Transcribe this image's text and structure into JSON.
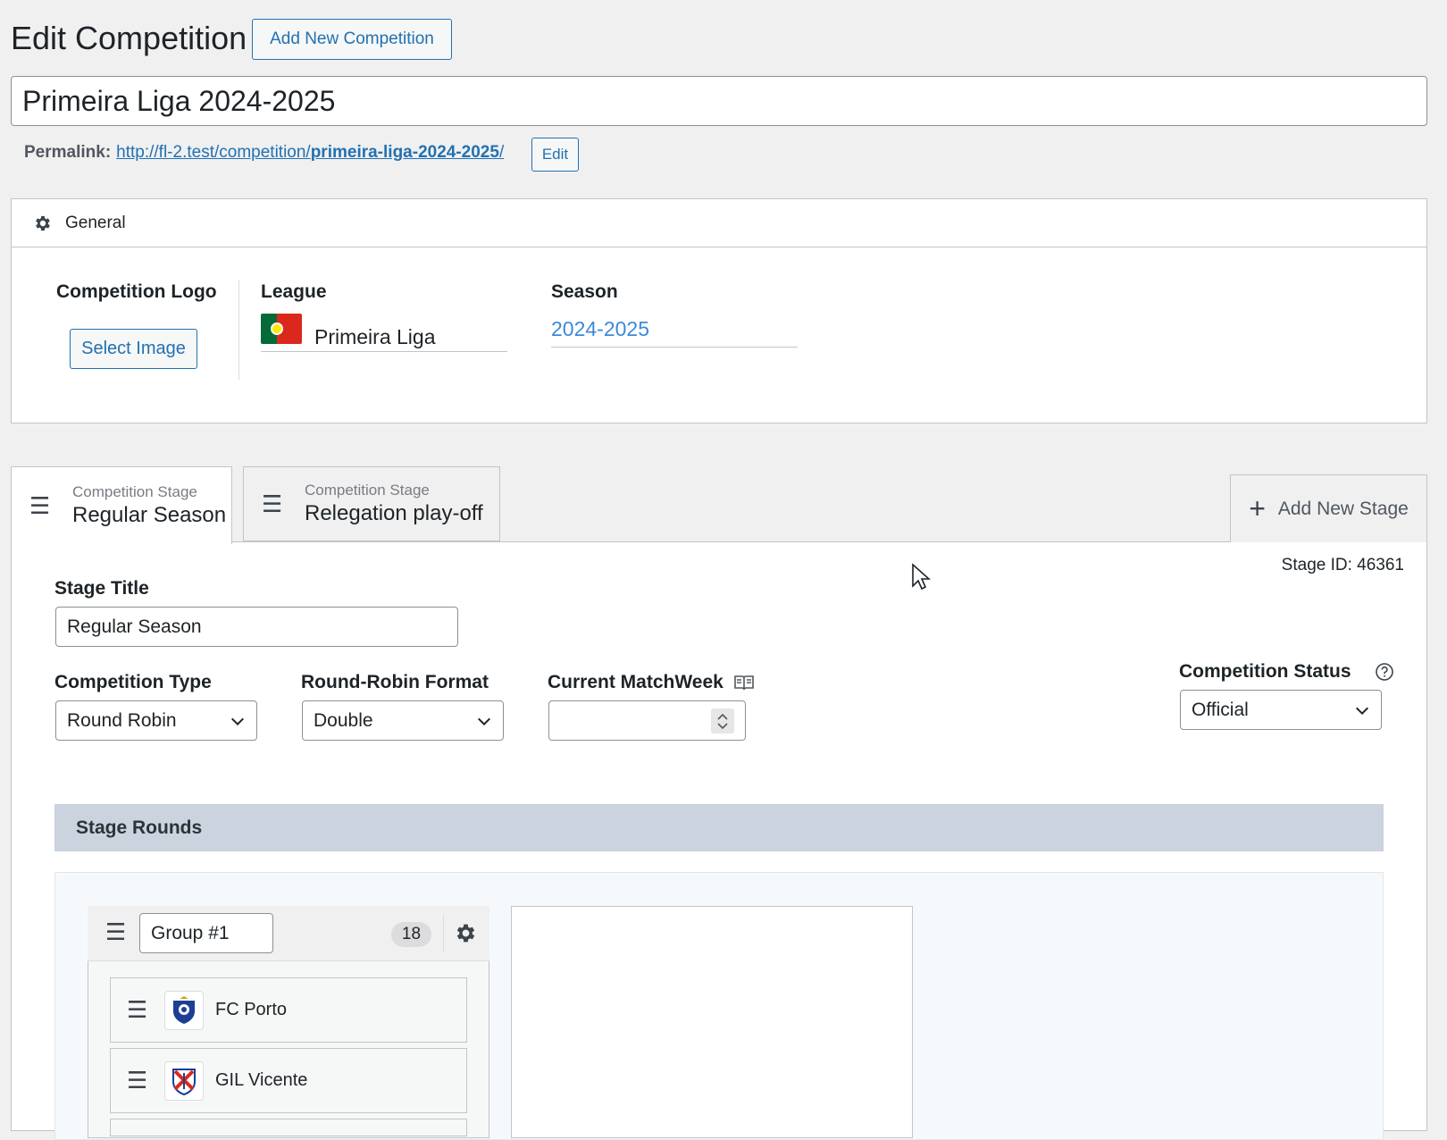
{
  "header": {
    "title": "Edit Competition",
    "add_new_label": "Add New Competition"
  },
  "post_title": "Primeira Liga 2024-2025",
  "permalink": {
    "label": "Permalink:",
    "url_prefix": "http://fl-2.test/competition/",
    "url_slug": "primeira-liga-2024-2025",
    "url_suffix": "/",
    "edit_label": "Edit"
  },
  "general": {
    "heading": "General",
    "icon": "gear-icon",
    "logo_label": "Competition Logo",
    "select_image_label": "Select Image",
    "league_label": "League",
    "league_value": "Primeira Liga",
    "league_flag": "portugal-flag",
    "season_label": "Season",
    "season_value": "2024-2025"
  },
  "tabs": [
    {
      "sub": "Competition Stage",
      "label": "Regular Season",
      "active": true
    },
    {
      "sub": "Competition Stage",
      "label": "Relegation play-off",
      "active": false
    }
  ],
  "add_stage_label": "Add New Stage",
  "stage": {
    "id_text": "Stage ID: 46361",
    "title_label": "Stage Title",
    "title_value": "Regular Season",
    "type_label": "Competition Type",
    "type_value": "Round Robin",
    "format_label": "Round-Robin Format",
    "format_value": "Double",
    "matchweek_label": "Current MatchWeek",
    "matchweek_value": "",
    "status_label": "Competition Status",
    "status_value": "Official"
  },
  "rounds": {
    "heading": "Stage Rounds",
    "group_name": "Group #1",
    "team_count": "18",
    "teams": [
      {
        "name": "FC Porto",
        "logo": "fc-porto-crest"
      },
      {
        "name": "GIL Vicente",
        "logo": "gil-vicente-crest"
      }
    ]
  },
  "colors": {
    "accent": "#2271b1",
    "season_link": "#3b8ad9",
    "rounds_bar": "#cad3de",
    "background": "#f0f0f1"
  }
}
